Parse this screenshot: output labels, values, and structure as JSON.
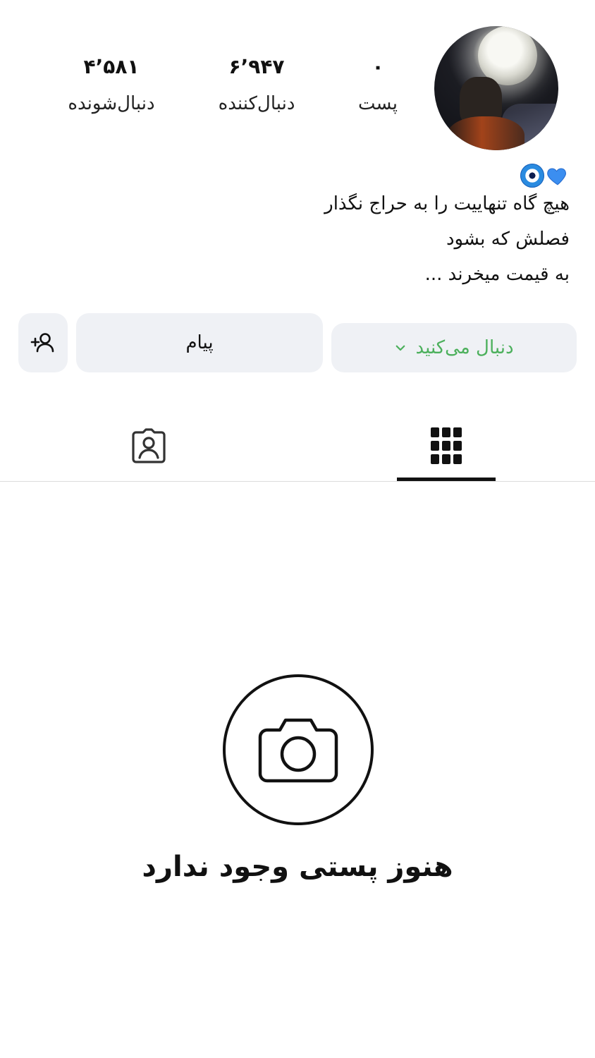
{
  "profile": {
    "stats": [
      {
        "key": "posts",
        "value": "۰",
        "label": "پست"
      },
      {
        "key": "followers",
        "value": "۶٬۹۴۷",
        "label": "دنبال‌کننده"
      },
      {
        "key": "following",
        "value": "۴٬۵۸۱",
        "label": "دنبال‌شونده"
      }
    ],
    "bio_lines": [
      "هیچ گاه تنهاییت را به حراج نگذار",
      "فصلش که بشود",
      "به قیمت میخرند ..."
    ],
    "bio_emoji": [
      "nazar-eye-icon",
      "blue-heart-icon"
    ]
  },
  "actions": {
    "following_label": "دنبال می‌کنید",
    "message_label": "پیام",
    "add_person_icon": "add-person-icon"
  },
  "tabs": [
    {
      "name": "posts-grid",
      "icon": "grid-icon",
      "active": true
    },
    {
      "name": "tagged",
      "icon": "tagged-person-icon",
      "active": false
    }
  ],
  "empty_state": {
    "icon": "camera-icon",
    "text": "هنوز پستی وجود ندارد"
  },
  "colors": {
    "accent_green": "#4cb05c",
    "button_bg": "#eff1f5"
  }
}
